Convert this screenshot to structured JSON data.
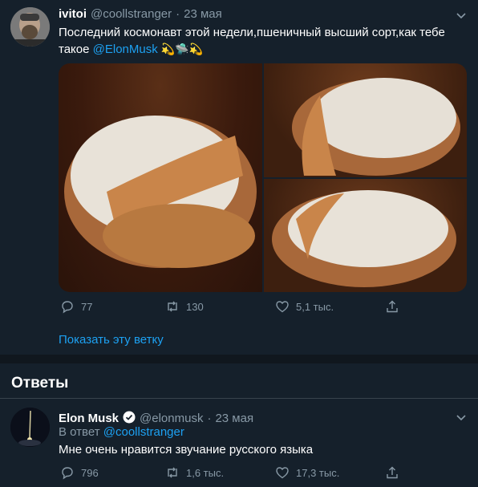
{
  "tweet": {
    "author_name": "ivitoi",
    "handle": "@coollstranger",
    "separator": "·",
    "date": "23 мая",
    "text_main": "Последний космонавт этой недели,пшеничный высший сорт,как тебе такое",
    "mention": "@ElonMusk",
    "emojis": "💫🛸💫",
    "stats": {
      "replies": "77",
      "retweets": "130",
      "likes": "5,1 тыс."
    },
    "show_thread": "Показать эту ветку"
  },
  "replies_section": {
    "title": "Ответы"
  },
  "reply": {
    "author_name": "Elon Musk",
    "handle": "@elonmusk",
    "separator": "·",
    "date": "23 мая",
    "reply_to_prefix": "В ответ",
    "reply_to_handle": "@coollstranger",
    "text": "Мне очень нравится звучание русского языка",
    "stats": {
      "replies": "796",
      "retweets": "1,6 тыс.",
      "likes": "17,3 тыс."
    }
  },
  "colors": {
    "background": "#15202b",
    "accent": "#1da1f2",
    "muted": "#8899a6",
    "divider": "#38444d"
  },
  "icons": [
    "chevron-down-icon",
    "reply-icon",
    "retweet-icon",
    "like-icon",
    "share-icon",
    "verified-icon"
  ]
}
